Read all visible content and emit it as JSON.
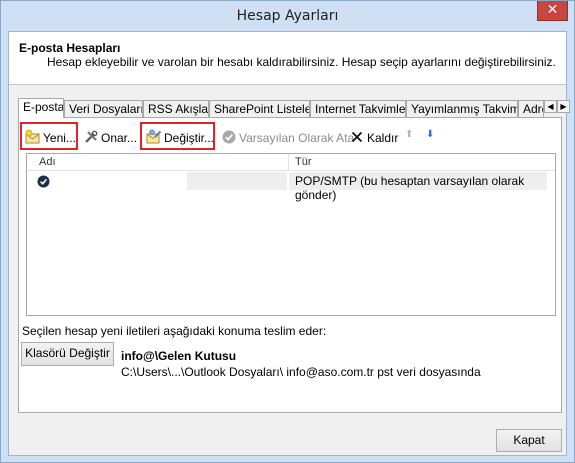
{
  "window": {
    "title": "Hesap Ayarları",
    "close_glyph": "✕"
  },
  "header": {
    "title": "E-posta Hesapları",
    "description": "Hesap ekleyebilir ve varolan bir hesabı kaldırabilirsiniz. Hesap seçip ayarlarını değiştirebilirsiniz."
  },
  "tabs": [
    {
      "label": "E-posta",
      "active": true
    },
    {
      "label": "Veri Dosyaları",
      "active": false
    },
    {
      "label": "RSS Akışları",
      "active": false
    },
    {
      "label": "SharePoint Listeleri",
      "active": false
    },
    {
      "label": "Internet Takvimleri",
      "active": false
    },
    {
      "label": "Yayımlanmış Takvimler",
      "active": false
    },
    {
      "label": "Adre",
      "active": false
    }
  ],
  "tab_scroll": {
    "left": "◀",
    "right": "▶"
  },
  "toolbar": {
    "new_label": "Yeni...",
    "repair_label": "Onar...",
    "change_label": "Değiştir...",
    "set_default_label": "Varsayılan Olarak Ata",
    "remove_label": "Kaldır",
    "move_up_glyph": "⬆",
    "move_down_glyph": "⬇"
  },
  "list": {
    "columns": [
      "Adı",
      "Tür"
    ],
    "rows": [
      {
        "name": "",
        "type": "POP/SMTP (bu hesaptan varsayılan olarak gönder)",
        "default": true
      }
    ]
  },
  "delivery": {
    "text": "Seçilen hesap yeni iletileri aşağıdaki konuma teslim eder:",
    "change_folder_label": "Klasörü Değiştir",
    "folder_name": "info@\\Gelen Kutusu",
    "folder_path": "C:\\Users\\...\\Outlook Dosyaları\\ info@aso.com.tr pst veri dosyasında"
  },
  "footer": {
    "close_label": "Kapat"
  },
  "colors": {
    "title_bg": "#cfe0f4",
    "close_red": "#c7463f",
    "highlight_red": "#e0242a",
    "move_down_blue": "#2a6fd6"
  }
}
